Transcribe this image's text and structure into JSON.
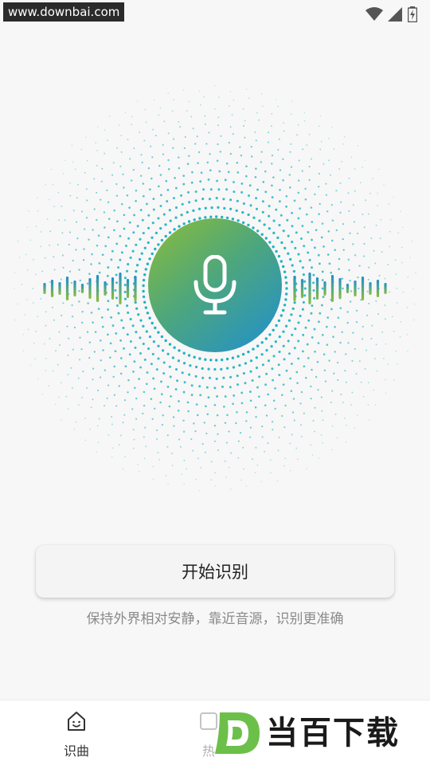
{
  "status_bar": {
    "watermark_url": "www.downbai.com",
    "icons": [
      "wifi-icon",
      "cellular-signal-icon",
      "battery-charging-icon"
    ]
  },
  "visualizer": {
    "dot_color": "#1fb3c4",
    "wave_colors": [
      "#8cbd39",
      "#1f8fd0"
    ],
    "mic_gradient": [
      "#8cbd39",
      "#4fa77a",
      "#1f8fd0"
    ]
  },
  "main": {
    "start_button_label": "开始识别",
    "hint_text": "保持外界相对安静，靠近音源，识别更准确"
  },
  "bottom_nav": {
    "items": [
      {
        "label": "识曲",
        "icon": "home-face-icon",
        "active": true
      },
      {
        "label": "热",
        "icon": "chart-icon",
        "active": false
      }
    ]
  },
  "brand_logo": {
    "letter": "D",
    "text": "当百下载",
    "color": "#6cc04a"
  }
}
